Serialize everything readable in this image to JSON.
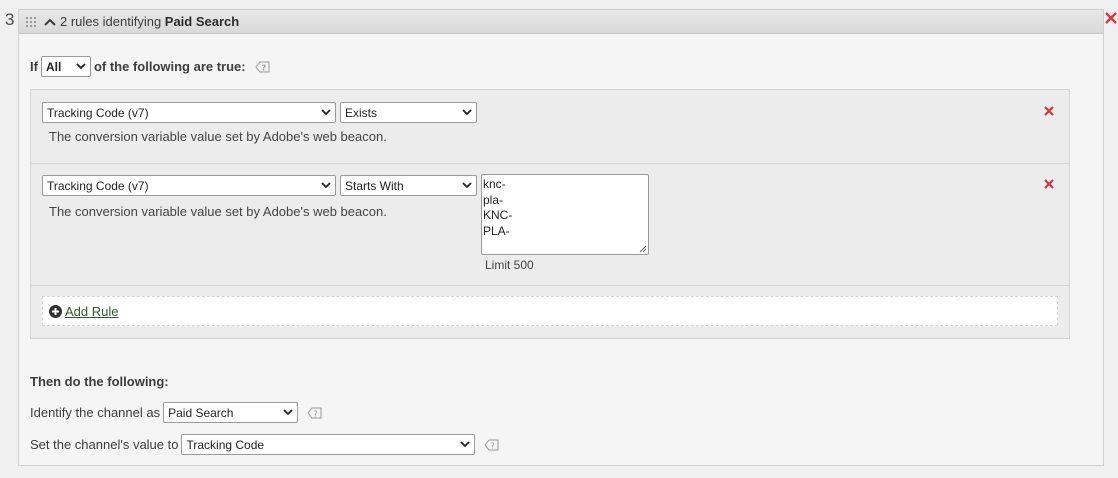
{
  "rule_number": "3",
  "header": {
    "prefix": "2 rules identifying ",
    "channel": "Paid Search"
  },
  "condition": {
    "if_label": "If",
    "match_value": "All",
    "suffix": "of the following are true:"
  },
  "rules": [
    {
      "dimension": "Tracking Code (v7)",
      "operator": "Exists",
      "description": "The conversion variable value set by Adobe's web beacon."
    },
    {
      "dimension": "Tracking Code (v7)",
      "operator": "Starts With",
      "description": "The conversion variable value set by Adobe's web beacon.",
      "values": [
        "knc-",
        "pla-",
        "KNC-",
        "PLA-"
      ],
      "limit": "Limit 500"
    }
  ],
  "add_rule_label": "Add Rule",
  "then": {
    "title": "Then do the following:",
    "identify_label": "Identify the channel as",
    "identify_value": "Paid Search",
    "set_label": "Set the channel's value to",
    "set_value": "Tracking Code"
  },
  "colors": {
    "remove": "#d7373f",
    "link": "#2d5f2d"
  }
}
